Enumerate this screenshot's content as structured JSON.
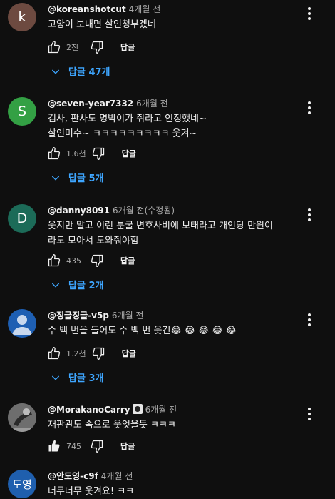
{
  "comments": [
    {
      "avatar_text": "k",
      "avatar_color": "#6d4a40",
      "author": "@koreanshotcut",
      "time": "4개월 전",
      "lines": [
        "고양이 보내면 살인청부겠네"
      ],
      "likes": "2천",
      "reply_label": "답글",
      "replies": "답글 47개"
    },
    {
      "avatar_text": "S",
      "avatar_color": "#33a044",
      "author": "@seven-year7332",
      "time": "6개월 전",
      "lines": [
        "검사, 판사도 명박이가 쥐라고 인정했네~",
        "살인미수~ ㅋㅋㅋㅋㅋㅋㅋㅋㅋ 웃겨~"
      ],
      "likes": "1.6천",
      "reply_label": "답글",
      "replies": "답글 5개"
    },
    {
      "avatar_text": "D",
      "avatar_color": "#1c6b58",
      "author": "@danny8091",
      "time": "6개월 전(수정됨)",
      "lines": [
        "웃지만 말고 이런 분굴 변호사비에 보태라고 개인당 만원이",
        "라도 모아서 도와줘야함"
      ],
      "likes": "435",
      "reply_label": "답글",
      "replies": "답글 2개"
    },
    {
      "avatar_text": "",
      "avatar_color": "#1e5fb3",
      "author": "@징글징글-v5p",
      "time": "6개월 전",
      "lines": [
        "수 백 번을 들어도 수 백 번 웃긴😂 😂 😂 😂 😂"
      ],
      "likes": "1.2천",
      "reply_label": "답글",
      "replies": "답글 3개"
    },
    {
      "avatar_text": "",
      "avatar_color": "#5a5a5a",
      "author": "@MorakanoCarry",
      "time": "6개월 전",
      "lines": [
        "재판관도 속으로 웃엇을듯 ㅋㅋㅋ"
      ],
      "likes": "745",
      "reply_label": "답글",
      "replies": ""
    },
    {
      "avatar_text": "도영",
      "avatar_color": "#1f5fae",
      "author": "@안도영-c9f",
      "time": "4개월 전",
      "lines": [
        "너무너무 웃겨요! ㅋㅋ"
      ],
      "likes": "",
      "reply_label": "답글",
      "replies": ""
    }
  ],
  "icons": {
    "like": "thumb-up-icon",
    "dislike": "thumb-down-icon",
    "more": "more-vert-icon",
    "replies": "chevron-down-icon"
  },
  "colors": {
    "background": "#0f0f0f",
    "link": "#3ea6ff",
    "secondary_text": "#aaaaaa"
  }
}
